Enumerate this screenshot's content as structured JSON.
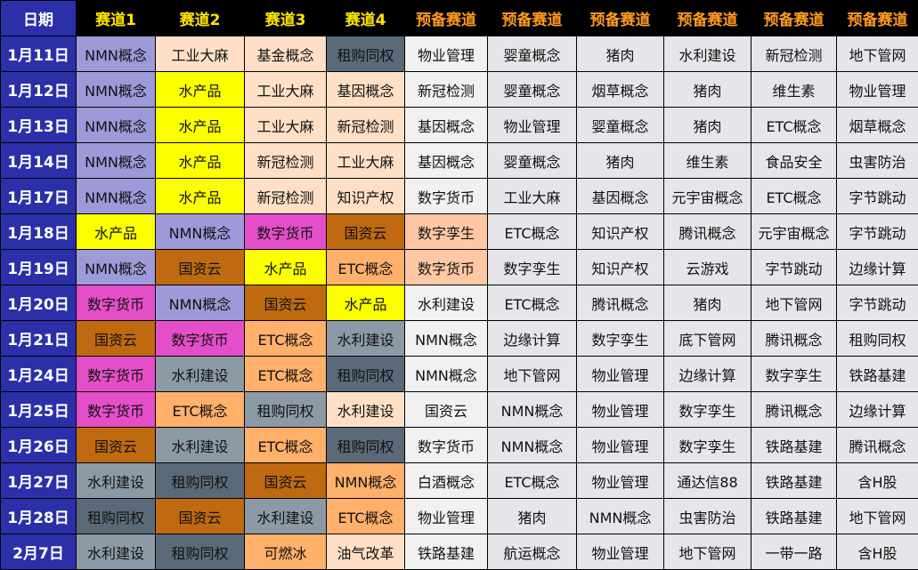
{
  "headers": [
    "日期",
    "赛道1",
    "赛道2",
    "赛道3",
    "赛道4",
    "预备赛道",
    "预备赛道",
    "预备赛道",
    "预备赛道",
    "预备赛道",
    "预备赛道"
  ],
  "colors": {
    "date_bg": "#2b2fa8",
    "lane_header_text": "#ffe400",
    "reserve_header_text": "#ff9a1e",
    "reserve_bg": "#e6e6ea",
    "nmn": "#9e9ad9",
    "guozi_yun": "#bf6a10",
    "shuzi_huobi": "#e44fc9",
    "shuichanpin": "#fbff00",
    "shuili_jianshe": "#8c9aa6",
    "zugou_tongquan": "#5b6a78",
    "etc": "#ffb06a",
    "light_orange": "#ffe0c6",
    "peach": "#ffc8a4",
    "white": "#f1f1f1"
  },
  "rows": [
    {
      "date": "1月11日",
      "lanes": [
        {
          "t": "NMN概念",
          "c": "c-nmn"
        },
        {
          "t": "工业大麻",
          "c": "c-lt"
        },
        {
          "t": "基金概念",
          "c": "c-lt"
        },
        {
          "t": "租购同权",
          "c": "c-zg"
        },
        {
          "t": "物业管理",
          "c": "c-w"
        }
      ],
      "reserve": [
        "婴童概念",
        "猪肉",
        "水利建设",
        "新冠检测",
        "地下管网"
      ]
    },
    {
      "date": "1月12日",
      "lanes": [
        {
          "t": "NMN概念",
          "c": "c-nmn"
        },
        {
          "t": "水产品",
          "c": "c-scp"
        },
        {
          "t": "工业大麻",
          "c": "c-lt"
        },
        {
          "t": "基因概念",
          "c": "c-lt"
        },
        {
          "t": "新冠检测",
          "c": "c-w"
        }
      ],
      "reserve": [
        "婴童概念",
        "烟草概念",
        "猪肉",
        "维生素",
        "物业管理"
      ]
    },
    {
      "date": "1月13日",
      "lanes": [
        {
          "t": "NMN概念",
          "c": "c-nmn"
        },
        {
          "t": "水产品",
          "c": "c-scp"
        },
        {
          "t": "工业大麻",
          "c": "c-lt"
        },
        {
          "t": "新冠检测",
          "c": "c-lt"
        },
        {
          "t": "基因概念",
          "c": "c-w"
        }
      ],
      "reserve": [
        "物业管理",
        "婴童概念",
        "猪肉",
        "ETC概念",
        "烟草概念"
      ]
    },
    {
      "date": "1月14日",
      "lanes": [
        {
          "t": "NMN概念",
          "c": "c-nmn"
        },
        {
          "t": "水产品",
          "c": "c-scp"
        },
        {
          "t": "新冠检测",
          "c": "c-lt"
        },
        {
          "t": "工业大麻",
          "c": "c-lt"
        },
        {
          "t": "基因概念",
          "c": "c-w"
        }
      ],
      "reserve": [
        "婴童概念",
        "猪肉",
        "维生素",
        "食品安全",
        "虫害防治"
      ]
    },
    {
      "date": "1月17日",
      "lanes": [
        {
          "t": "NMN概念",
          "c": "c-nmn"
        },
        {
          "t": "水产品",
          "c": "c-scp"
        },
        {
          "t": "新冠检测",
          "c": "c-lt"
        },
        {
          "t": "知识产权",
          "c": "c-lt"
        },
        {
          "t": "数字货币",
          "c": "c-w"
        }
      ],
      "reserve": [
        "工业大麻",
        "基因概念",
        "元宇宙概念",
        "ETC概念",
        "字节跳动"
      ]
    },
    {
      "date": "1月18日",
      "lanes": [
        {
          "t": "水产品",
          "c": "c-scp"
        },
        {
          "t": "NMN概念",
          "c": "c-nmn"
        },
        {
          "t": "数字货币",
          "c": "c-szhb"
        },
        {
          "t": "国资云",
          "c": "c-gy"
        },
        {
          "t": "数字孪生",
          "c": "c-peach"
        }
      ],
      "reserve": [
        "ETC概念",
        "知识产权",
        "腾讯概念",
        "元宇宙概念",
        "字节跳动"
      ]
    },
    {
      "date": "1月19日",
      "lanes": [
        {
          "t": "NMN概念",
          "c": "c-nmn"
        },
        {
          "t": "国资云",
          "c": "c-gy"
        },
        {
          "t": "水产品",
          "c": "c-scp"
        },
        {
          "t": "ETC概念",
          "c": "c-etc"
        },
        {
          "t": "数字货币",
          "c": "c-peach"
        }
      ],
      "reserve": [
        "数字孪生",
        "知识产权",
        "云游戏",
        "字节跳动",
        "边缘计算"
      ]
    },
    {
      "date": "1月20日",
      "lanes": [
        {
          "t": "数字货币",
          "c": "c-szhb"
        },
        {
          "t": "NMN概念",
          "c": "c-nmn"
        },
        {
          "t": "国资云",
          "c": "c-gy"
        },
        {
          "t": "水产品",
          "c": "c-scp"
        },
        {
          "t": "水利建设",
          "c": "c-w"
        }
      ],
      "reserve": [
        "ETC概念",
        "腾讯概念",
        "猪肉",
        "地下管网",
        "字节跳动"
      ]
    },
    {
      "date": "1月21日",
      "lanes": [
        {
          "t": "国资云",
          "c": "c-gy"
        },
        {
          "t": "数字货币",
          "c": "c-szhb"
        },
        {
          "t": "ETC概念",
          "c": "c-etc"
        },
        {
          "t": "水利建设",
          "c": "c-slj"
        },
        {
          "t": "NMN概念",
          "c": "c-w"
        }
      ],
      "reserve": [
        "边缘计算",
        "数字孪生",
        "底下管网",
        "腾讯概念",
        "租购同权"
      ]
    },
    {
      "date": "1月24日",
      "lanes": [
        {
          "t": "数字货币",
          "c": "c-szhb"
        },
        {
          "t": "水利建设",
          "c": "c-slj"
        },
        {
          "t": "ETC概念",
          "c": "c-etc"
        },
        {
          "t": "租购同权",
          "c": "c-zg"
        },
        {
          "t": "NMN概念",
          "c": "c-w"
        }
      ],
      "reserve": [
        "地下管网",
        "物业管理",
        "边缘计算",
        "数字孪生",
        "铁路基建"
      ]
    },
    {
      "date": "1月25日",
      "lanes": [
        {
          "t": "数字货币",
          "c": "c-szhb"
        },
        {
          "t": "ETC概念",
          "c": "c-etc"
        },
        {
          "t": "租购同权",
          "c": "c-slj"
        },
        {
          "t": "水利建设",
          "c": "c-lt"
        },
        {
          "t": "国资云",
          "c": "c-w"
        }
      ],
      "reserve": [
        "NMN概念",
        "物业管理",
        "数字孪生",
        "腾讯概念",
        "边缘计算"
      ]
    },
    {
      "date": "1月26日",
      "lanes": [
        {
          "t": "国资云",
          "c": "c-gy"
        },
        {
          "t": "水利建设",
          "c": "c-slj"
        },
        {
          "t": "ETC概念",
          "c": "c-etc"
        },
        {
          "t": "租购同权",
          "c": "c-zg"
        },
        {
          "t": "数字货币",
          "c": "c-w"
        }
      ],
      "reserve": [
        "NMN概念",
        "物业管理",
        "数字孪生",
        "铁路基建",
        "腾讯概念"
      ]
    },
    {
      "date": "1月27日",
      "lanes": [
        {
          "t": "水利建设",
          "c": "c-slj"
        },
        {
          "t": "租购同权",
          "c": "c-zg"
        },
        {
          "t": "国资云",
          "c": "c-gy"
        },
        {
          "t": "NMN概念",
          "c": "c-etc"
        },
        {
          "t": "白酒概念",
          "c": "c-w"
        }
      ],
      "reserve": [
        "ETC概念",
        "物业管理",
        "通达信88",
        "铁路基建",
        "含H股"
      ]
    },
    {
      "date": "1月28日",
      "lanes": [
        {
          "t": "租购同权",
          "c": "c-zg"
        },
        {
          "t": "国资云",
          "c": "c-gy"
        },
        {
          "t": "水利建设",
          "c": "c-slj"
        },
        {
          "t": "ETC概念",
          "c": "c-etc"
        },
        {
          "t": "物业管理",
          "c": "c-w"
        }
      ],
      "reserve": [
        "猪肉",
        "NMN概念",
        "虫害防治",
        "铁路基建",
        "地下管网"
      ]
    },
    {
      "date": "2月7日",
      "lanes": [
        {
          "t": "水利建设",
          "c": "c-slj"
        },
        {
          "t": "租购同权",
          "c": "c-zg"
        },
        {
          "t": "可燃冰",
          "c": "c-etc"
        },
        {
          "t": "油气改革",
          "c": "c-lt"
        },
        {
          "t": "铁路基建",
          "c": "c-w"
        }
      ],
      "reserve": [
        "航运概念",
        "物业管理",
        "地下管网",
        "一带一路",
        "含H股"
      ]
    }
  ]
}
